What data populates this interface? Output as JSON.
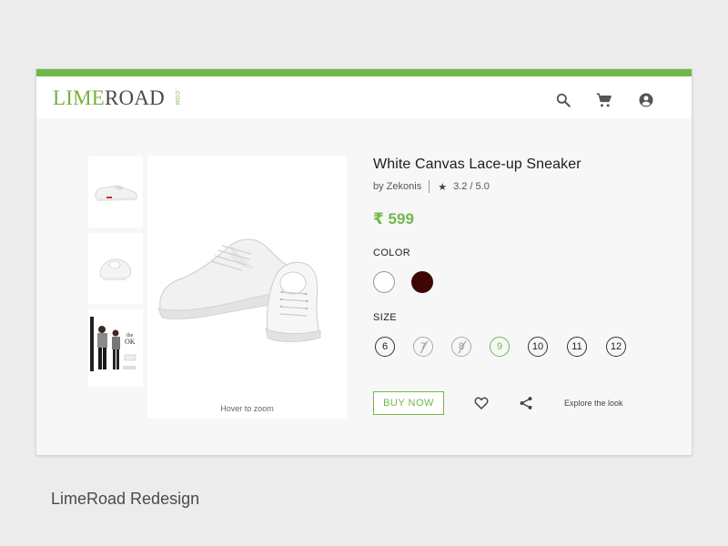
{
  "brand": {
    "logo_part1": "LIME",
    "logo_part2": "ROAD",
    "logo_suffix": ".COM"
  },
  "colors": {
    "accent": "#70b84c",
    "swatch_white": "#ffffff",
    "swatch_maroon": "#3f0606"
  },
  "header_icons": [
    "search-icon",
    "cart-icon",
    "account-icon"
  ],
  "product": {
    "title": "White Canvas Lace-up Sneaker",
    "brand": "by Zekonis",
    "rating": "3.2 / 5.0",
    "price": "₹ 599",
    "zoom_hint": "Hover to zoom"
  },
  "color_section": {
    "label": "COLOR"
  },
  "size_section": {
    "label": "SIZE",
    "sizes": [
      {
        "label": "6",
        "state": "available"
      },
      {
        "label": "7",
        "state": "unavailable"
      },
      {
        "label": "8",
        "state": "unavailable"
      },
      {
        "label": "9",
        "state": "selected"
      },
      {
        "label": "10",
        "state": "available"
      },
      {
        "label": "11",
        "state": "available"
      },
      {
        "label": "12",
        "state": "available"
      }
    ]
  },
  "actions": {
    "buy_now": "BUY NOW",
    "explore": "Explore the look"
  },
  "caption": "LimeRoad Redesign"
}
